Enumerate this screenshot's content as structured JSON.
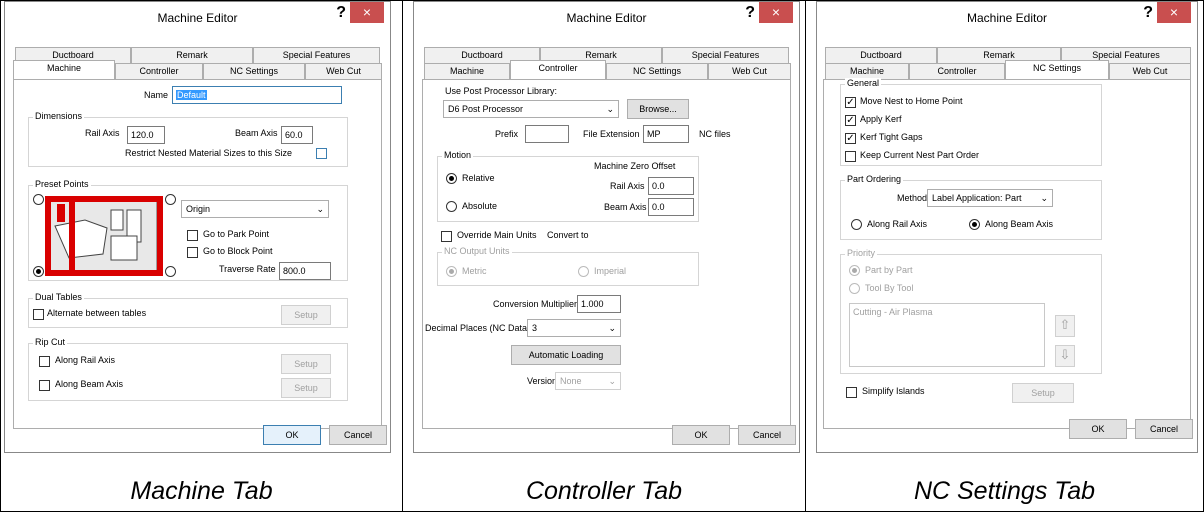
{
  "common": {
    "window_title": "Machine Editor",
    "help": "?",
    "close": "×",
    "ok": "OK",
    "cancel": "Cancel",
    "dropdown_caret": "⌄",
    "tabs": [
      "Ductboard",
      "Remark",
      "Special Features",
      "Machine",
      "Controller",
      "NC Settings",
      "Web Cut"
    ]
  },
  "captions": [
    "Machine Tab",
    "Controller Tab",
    "NC Settings Tab"
  ],
  "machine_tab": {
    "name_label": "Name",
    "name_value": "Default",
    "dimensions": {
      "label": "Dimensions",
      "rail_axis_label": "Rail Axis",
      "rail_axis_value": "120.0",
      "beam_axis_label": "Beam Axis",
      "beam_axis_value": "60.0",
      "restrict_label": "Restrict Nested Material Sizes to this Size"
    },
    "preset_points": {
      "label": "Preset Points",
      "origin_value": "Origin",
      "go_to_park": "Go to Park Point",
      "go_to_block": "Go to Block Point",
      "traverse_rate_label": "Traverse Rate",
      "traverse_rate_value": "800.0"
    },
    "dual_tables": {
      "label": "Dual Tables",
      "alternate_label": "Alternate between tables",
      "setup": "Setup"
    },
    "rip_cut": {
      "label": "Rip Cut",
      "along_rail": "Along Rail Axis",
      "along_beam": "Along Beam Axis",
      "setup": "Setup"
    }
  },
  "controller_tab": {
    "post_processor_label": "Use Post Processor Library:",
    "post_processor_value": "D6 Post Processor",
    "browse": "Browse...",
    "prefix_label": "Prefix",
    "prefix_value": "",
    "file_ext_label": "File Extension",
    "file_ext_value": "MP",
    "nc_files": "NC files",
    "motion": {
      "label": "Motion",
      "relative": "Relative",
      "absolute": "Absolute",
      "mzo_label": "Machine Zero Offset",
      "rail_axis_label": "Rail Axis",
      "rail_axis_value": "0.0",
      "beam_axis_label": "Beam Axis",
      "beam_axis_value": "0.0"
    },
    "override_label": "Override Main Units",
    "convert_to": "Convert to",
    "nc_output_units": {
      "label": "NC Output Units",
      "metric": "Metric",
      "imperial": "Imperial"
    },
    "conversion_multiplier_label": "Conversion Multiplier",
    "conversion_multiplier_value": "1.000",
    "decimal_places_label": "Decimal Places (NC Data)",
    "decimal_places_value": "3",
    "automatic_loading": "Automatic Loading",
    "version_label": "Version",
    "version_value": "None"
  },
  "nc_settings_tab": {
    "general": {
      "label": "General",
      "move_nest": "Move Nest to Home Point",
      "apply_kerf": "Apply Kerf",
      "kerf_tight": "Kerf Tight Gaps",
      "keep_order": "Keep Current Nest Part Order"
    },
    "part_ordering": {
      "label": "Part Ordering",
      "method_label": "Method",
      "method_value": "Label Application: Part",
      "along_rail": "Along Rail Axis",
      "along_beam": "Along Beam Axis"
    },
    "priority": {
      "label": "Priority",
      "part_by_part": "Part by Part",
      "tool_by_tool": "Tool By Tool",
      "list_item": "Cutting - Air Plasma",
      "up_arrow": "⇧",
      "down_arrow": "⇩"
    },
    "simplify_islands": "Simplify Islands",
    "setup": "Setup"
  }
}
